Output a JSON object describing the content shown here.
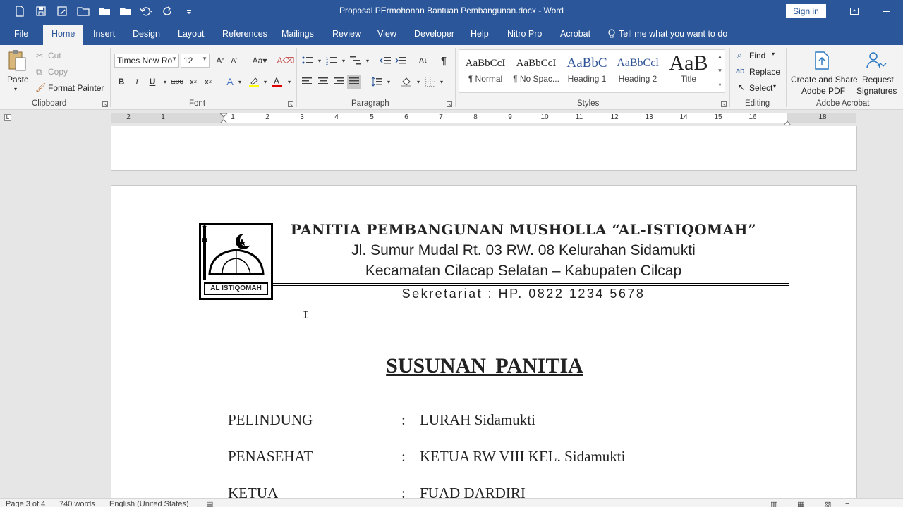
{
  "window": {
    "title": "Proposal PErmohonan Bantuan Pembangunan.docx  -  Word",
    "signin": "Sign in"
  },
  "tabs": [
    {
      "label": "File"
    },
    {
      "label": "Home"
    },
    {
      "label": "Insert"
    },
    {
      "label": "Design"
    },
    {
      "label": "Layout"
    },
    {
      "label": "References"
    },
    {
      "label": "Mailings"
    },
    {
      "label": "Review"
    },
    {
      "label": "View"
    },
    {
      "label": "Developer"
    },
    {
      "label": "Help"
    },
    {
      "label": "Nitro Pro"
    },
    {
      "label": "Acrobat"
    }
  ],
  "tell_me": "Tell me what you want to do",
  "ribbon": {
    "clipboard": {
      "label": "Clipboard",
      "paste": "Paste",
      "cut": "Cut",
      "copy": "Copy",
      "format_painter": "Format Painter"
    },
    "font": {
      "label": "Font",
      "font_name": "Times New Ro",
      "font_size": "12"
    },
    "paragraph": {
      "label": "Paragraph"
    },
    "styles": {
      "label": "Styles",
      "items": [
        {
          "sample": "AaBbCcI",
          "name": "¶ Normal"
        },
        {
          "sample": "AaBbCcI",
          "name": "¶ No Spac..."
        },
        {
          "sample": "AaBbC",
          "name": "Heading 1"
        },
        {
          "sample": "AaBbCcl",
          "name": "Heading 2"
        },
        {
          "sample": "AaB",
          "name": "Title"
        }
      ]
    },
    "editing": {
      "label": "Editing",
      "find": "Find",
      "replace": "Replace",
      "select": "Select"
    },
    "acrobat": {
      "label": "Adobe Acrobat",
      "create_line1": "Create and Share",
      "create_line2": "Adobe PDF",
      "request_line1": "Request",
      "request_line2": "Signatures"
    }
  },
  "ruler": {
    "left_labels": [
      "2",
      "1"
    ],
    "labels": [
      "1",
      "2",
      "3",
      "4",
      "5",
      "6",
      "7",
      "8",
      "9",
      "10",
      "11",
      "12",
      "13",
      "14",
      "15",
      "16",
      "18"
    ]
  },
  "document": {
    "logo_text": "AL ISTIQOMAH",
    "kop_title": "PANITIA PEMBANGUNAN MUSHOLLA “AL-ISTIQOMAH”",
    "kop_address": "Jl. Sumur Mudal Rt. 03 RW. 08 Kelurahan Sidamukti",
    "kop_district": "Kecamatan Cilacap Selatan – Kabupaten Cilcap",
    "kop_secretariat": "Sekretariat : HP. 0822 1234 5678",
    "heading": "SUSUNAN  PANITIA",
    "rows": [
      {
        "key": "PELINDUNG",
        "colon": ":",
        "value": "LURAH Sidamukti"
      },
      {
        "key": "PENASEHAT",
        "colon": ":",
        "value": "KETUA RW VIII  KEL. Sidamukti"
      },
      {
        "key": "KETUA",
        "colon": ":",
        "value": "FUAD  DARDIRI"
      }
    ]
  },
  "status": {
    "page": "Page 3 of 4",
    "words": "740 words",
    "language": "English (United States)"
  }
}
